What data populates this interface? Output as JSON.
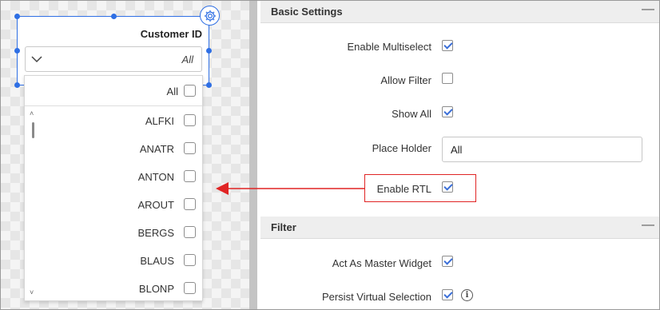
{
  "widget": {
    "title": "Customer ID",
    "combo_value": "All",
    "dropdown": {
      "all_label": "All",
      "items": [
        {
          "label": "ALFKI",
          "checked": false
        },
        {
          "label": "ANATR",
          "checked": false
        },
        {
          "label": "ANTON",
          "checked": false
        },
        {
          "label": "AROUT",
          "checked": false
        },
        {
          "label": "BERGS",
          "checked": false
        },
        {
          "label": "BLAUS",
          "checked": false
        },
        {
          "label": "BLONP",
          "checked": false
        }
      ]
    }
  },
  "panel": {
    "basic_settings": {
      "title": "Basic Settings",
      "collapse_glyph": "—",
      "enable_multiselect": {
        "label": "Enable Multiselect",
        "checked": true
      },
      "allow_filter": {
        "label": "Allow Filter",
        "checked": false
      },
      "show_all": {
        "label": "Show All",
        "checked": true
      },
      "place_holder": {
        "label": "Place Holder",
        "value": "All"
      },
      "enable_rtl": {
        "label": "Enable RTL",
        "checked": true
      }
    },
    "filter": {
      "title": "Filter",
      "collapse_glyph": "—",
      "act_as_master_widget": {
        "label": "Act As Master Widget",
        "checked": true
      },
      "persist_virtual_selection": {
        "label": "Persist Virtual Selection",
        "checked": true,
        "info_icon": "i"
      }
    }
  },
  "colors": {
    "selection_blue": "#2f6fe4",
    "highlight_red": "#e02424",
    "check_blue": "#3b6fd8"
  },
  "icons": [
    "gear-icon",
    "chevron-down-icon",
    "check-icon",
    "info-icon",
    "arrow-left-icon",
    "collapse-icon"
  ]
}
